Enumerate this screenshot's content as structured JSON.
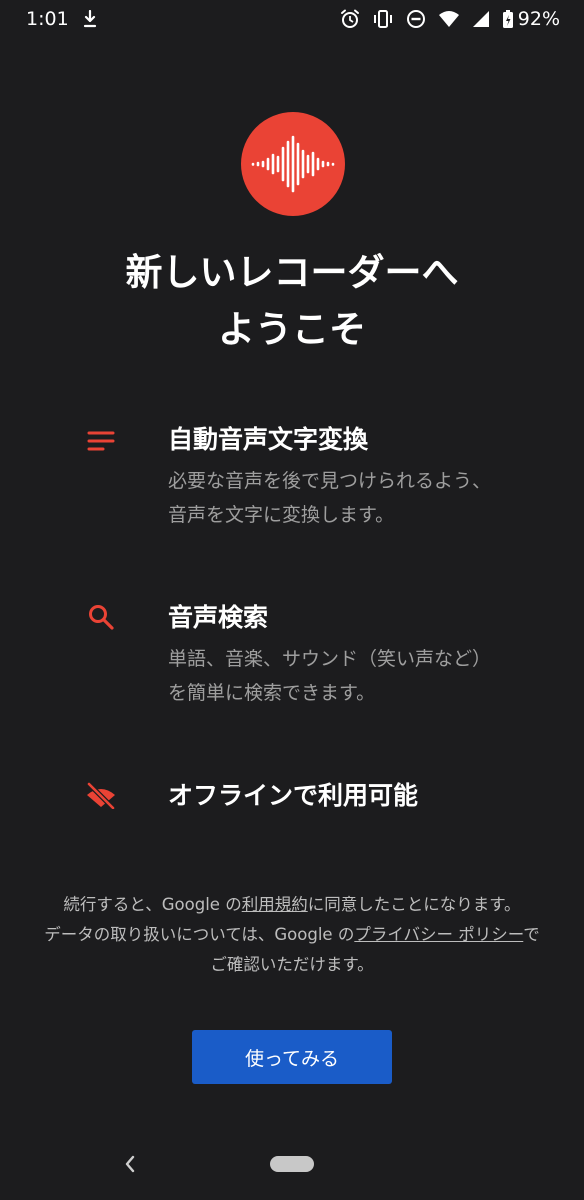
{
  "status_bar": {
    "time": "1:01",
    "battery_percent": "92%",
    "icons": [
      "download-notification-icon",
      "alarm-icon",
      "vibrate-icon",
      "do-not-disturb-icon",
      "wifi-icon",
      "signal-icon",
      "battery-charging-icon"
    ]
  },
  "header": {
    "logo_icon": "audio-waveform-icon",
    "title_line1": "新しいレコーダーへ",
    "title_line2": "ようこそ"
  },
  "features": [
    {
      "icon": "lines-transcript-icon",
      "title": "自動音声文字変換",
      "description": "必要な音声を後で見つけられるよう、音声を文字に変換します。"
    },
    {
      "icon": "search-icon",
      "title": "音声検索",
      "description": "単語、音楽、サウンド（笑い声など）を簡単に検索できます。"
    },
    {
      "icon": "offline-cloud-off-icon",
      "title": "オフラインで利用可能",
      "description": ""
    }
  ],
  "terms": {
    "line1_pre": "続行すると、Google の",
    "terms_link": "利用規約",
    "line1_post": "に同意したことになります。",
    "line2_pre": "データの取り扱いについては、Google の",
    "privacy_link": "プライバシー ポリシー",
    "line2_post": "で",
    "line3": "ご確認いただけます。"
  },
  "cta": {
    "label": "使ってみる"
  },
  "colors": {
    "background": "#1c1c1e",
    "accent_red": "#ea4335",
    "button_blue": "#1a5cc8",
    "secondary_text": "#9e9e9e"
  }
}
